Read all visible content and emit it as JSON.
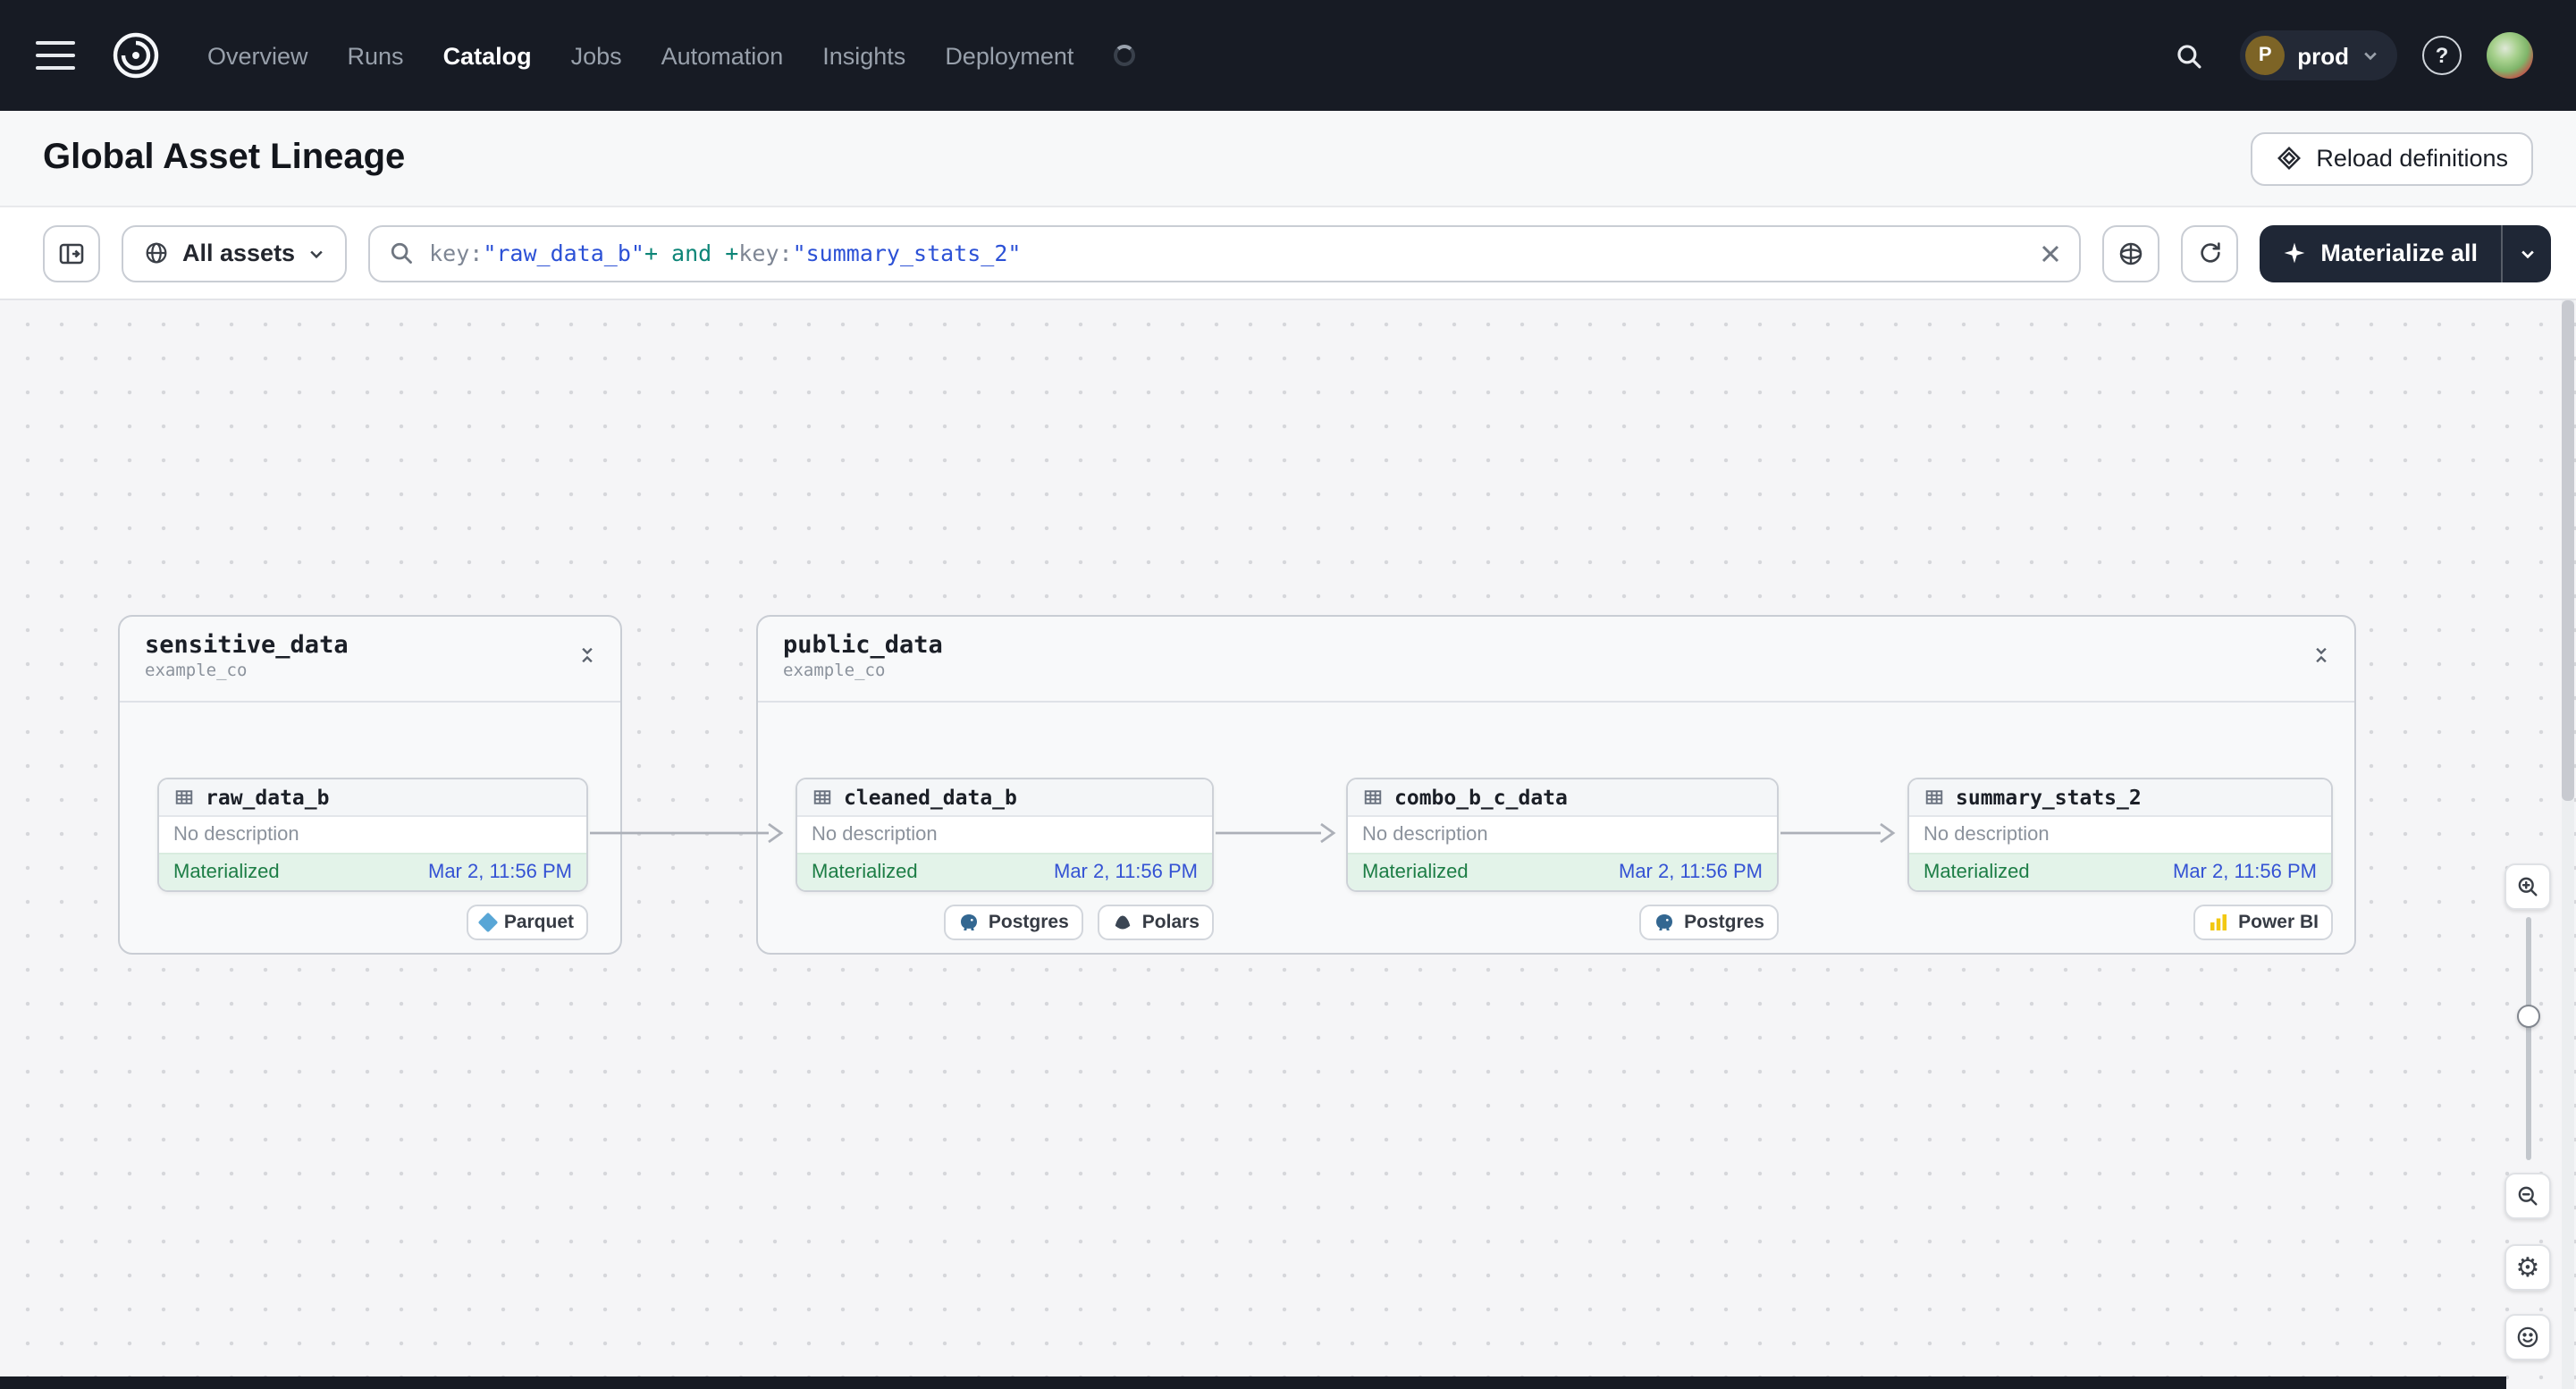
{
  "navbar": {
    "items": [
      "Overview",
      "Runs",
      "Catalog",
      "Jobs",
      "Automation",
      "Insights",
      "Deployment"
    ],
    "active_item": "Catalog",
    "deployment": {
      "initial": "P",
      "name": "prod"
    },
    "help_label": "?"
  },
  "header": {
    "title": "Global Asset Lineage",
    "reload_button": "Reload definitions"
  },
  "toolbar": {
    "scope": "All assets",
    "query": {
      "segments": [
        {
          "text": "key:",
          "type": "plain"
        },
        {
          "text": "\"raw_data_b\"",
          "type": "string"
        },
        {
          "text": "+",
          "type": "op"
        },
        {
          "text": " and ",
          "type": "keyword"
        },
        {
          "text": "+",
          "type": "op"
        },
        {
          "text": "key:",
          "type": "plain"
        },
        {
          "text": "\"summary_stats_2\"",
          "type": "string"
        }
      ]
    },
    "materialize_button": "Materialize all"
  },
  "graph": {
    "groups": [
      {
        "name": "sensitive_data",
        "subtitle": "example_co",
        "nodes": [
          {
            "name": "raw_data_b",
            "description": "No description",
            "status": "Materialized",
            "timestamp": "Mar 2, 11:56 PM",
            "tags": [
              {
                "label": "Parquet",
                "icon": "parquet-icon"
              }
            ]
          }
        ]
      },
      {
        "name": "public_data",
        "subtitle": "example_co",
        "nodes": [
          {
            "name": "cleaned_data_b",
            "description": "No description",
            "status": "Materialized",
            "timestamp": "Mar 2, 11:56 PM",
            "tags": [
              {
                "label": "Postgres",
                "icon": "postgres-icon"
              },
              {
                "label": "Polars",
                "icon": "polars-icon"
              }
            ]
          },
          {
            "name": "combo_b_c_data",
            "description": "No description",
            "status": "Materialized",
            "timestamp": "Mar 2, 11:56 PM",
            "tags": [
              {
                "label": "Postgres",
                "icon": "postgres-icon"
              }
            ]
          },
          {
            "name": "summary_stats_2",
            "description": "No description",
            "status": "Materialized",
            "timestamp": "Mar 2, 11:56 PM",
            "tags": [
              {
                "label": "Power BI",
                "icon": "powerbi-icon"
              }
            ]
          }
        ]
      }
    ]
  },
  "colors": {
    "navbar_bg": "#171b24",
    "status_green_text": "#1c7d45",
    "status_green_bg": "#e3f3e9",
    "timestamp_blue": "#3452d4",
    "query_string": "#2c51d6",
    "query_keyword": "#0d8577",
    "materialize_bg": "#1f2736"
  }
}
